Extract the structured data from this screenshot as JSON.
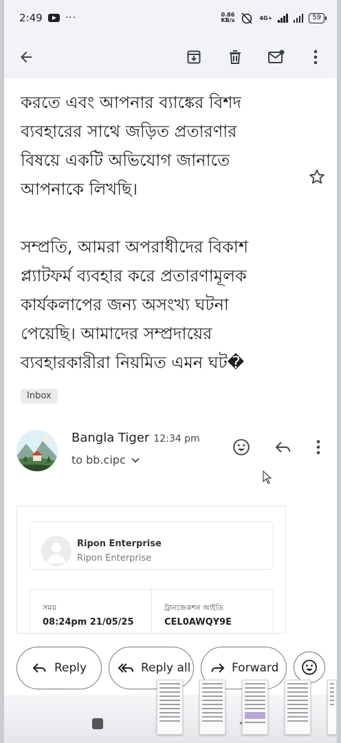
{
  "status_bar": {
    "time": "2:49",
    "dots": "···",
    "net_speed_value": "0.86",
    "net_speed_unit": "KB/s",
    "network_type": "4G+",
    "battery": "59"
  },
  "app_bar": {
    "icons": [
      "back-arrow-icon",
      "archive-icon",
      "delete-icon",
      "mark-unread-icon",
      "more-vert-icon"
    ]
  },
  "email": {
    "body_lines_1": [
      "করতে এবং আপনার ব্যাঙ্কের বিশদ",
      "ব্যবহারের সাথে জড়িত প্রতারণার",
      "বিষয়ে একটি অভিযোগ জানাতে",
      "আপনাকে লিখছি।"
    ],
    "body_lines_2": [
      "সম্প্রতি, আমরা অপরাধীদের বিকাশ",
      "প্ল্যাটফর্ম ব্যবহার করে প্রতারণামূলক",
      "কার্যকলাপের জন্য অসংখ্য ঘটনা",
      "পেয়েছি। আমাদের সম্প্রদায়ের",
      "ব্যবহারকারীরা নিয়মিত এমন ঘট�"
    ],
    "label_chip": "Inbox"
  },
  "message": {
    "sender": "Bangla Tiger",
    "time": "12:34 pm",
    "to": "to bb.cipc"
  },
  "receipt": {
    "merchant_name": "Ripon Enterprise",
    "merchant_sub": "Ripon Enterprise",
    "time_label": "সময়",
    "time_value": "08:24pm 21/05/25",
    "txn_label": "ট্রানজেকশন আইডি",
    "txn_value": "CEL0AWQY9E"
  },
  "actions": {
    "reply": "Reply",
    "reply_all": "Reply all",
    "forward": "Forward"
  },
  "colors": {
    "app_bar_bg": "#f1f3f6",
    "text": "#1f1f1f",
    "button_border": "#747775"
  }
}
